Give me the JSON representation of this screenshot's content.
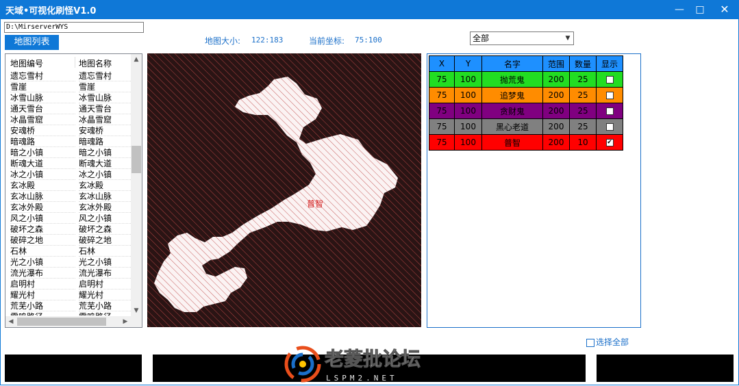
{
  "window": {
    "title": "天域•可视化刷怪V1.0",
    "minimize_glyph": "—",
    "maximize_glyph": "□",
    "close_glyph": "✕"
  },
  "path": {
    "value": "D:\\MirserverWYS"
  },
  "toolbar": {
    "map_list_label": "地图列表"
  },
  "info": {
    "map_size_label": "地图大小:",
    "map_size_value": "122:183",
    "coord_label": "当前坐标:",
    "coord_value": "75:100"
  },
  "filter": {
    "selected": "全部"
  },
  "map_list": {
    "headers": [
      "地图编号",
      "地图名称"
    ],
    "rows": [
      [
        "遗忘雪村",
        "遗忘雪村"
      ],
      [
        "雪崖",
        "雪崖"
      ],
      [
        "冰雪山脉",
        "冰雪山脉"
      ],
      [
        "通天雪台",
        "通天雪台"
      ],
      [
        "冰晶雪窟",
        "冰晶雪窟"
      ],
      [
        "安魂桥",
        "安魂桥"
      ],
      [
        "暗魂路",
        "暗魂路"
      ],
      [
        "暗之小镇",
        "暗之小镇"
      ],
      [
        "断魂大道",
        "断魂大道"
      ],
      [
        "冰之小镇",
        "冰之小镇"
      ],
      [
        "玄冰殿",
        "玄冰殿"
      ],
      [
        "玄冰山脉",
        "玄冰山脉"
      ],
      [
        "玄冰外殿",
        "玄冰外殿"
      ],
      [
        "风之小镇",
        "风之小镇"
      ],
      [
        "破坏之森",
        "破坏之森"
      ],
      [
        "破碎之地",
        "破碎之地"
      ],
      [
        "石林",
        "石林"
      ],
      [
        "光之小镇",
        "光之小镇"
      ],
      [
        "流光瀑布",
        "流光瀑布"
      ],
      [
        "启明村",
        "启明村"
      ],
      [
        "耀光村",
        "耀光村"
      ],
      [
        "荒芜小路",
        "荒芜小路"
      ],
      [
        "雷鸣路径",
        "雷鸣路径"
      ]
    ]
  },
  "map": {
    "marker_label": "普智"
  },
  "spawn_table": {
    "headers": [
      "X",
      "Y",
      "名字",
      "范围",
      "数量",
      "显示"
    ],
    "rows": [
      {
        "x": "75",
        "y": "100",
        "name": "抛荒鬼",
        "range": "200",
        "count": "25",
        "checked": false,
        "color": "#22dd22"
      },
      {
        "x": "75",
        "y": "100",
        "name": "追梦鬼",
        "range": "200",
        "count": "25",
        "checked": false,
        "color": "#ff8c00"
      },
      {
        "x": "75",
        "y": "100",
        "name": "贪财鬼",
        "range": "200",
        "count": "25",
        "checked": false,
        "color": "#800080"
      },
      {
        "x": "75",
        "y": "100",
        "name": "黑心老道",
        "range": "200",
        "count": "25",
        "checked": false,
        "color": "#808080"
      },
      {
        "x": "75",
        "y": "100",
        "name": "普智",
        "range": "200",
        "count": "10",
        "checked": true,
        "color": "#ff0000"
      }
    ]
  },
  "footer": {
    "select_all_label": "选择全部"
  },
  "watermark": {
    "text": "老菱批论坛",
    "subtext": "LSPM2.NET"
  },
  "colors": {
    "accent": "#0f78d7",
    "label_blue": "#1a6fc9",
    "map_bg": "#2a1414",
    "map_hatch": "#c84a4a"
  }
}
